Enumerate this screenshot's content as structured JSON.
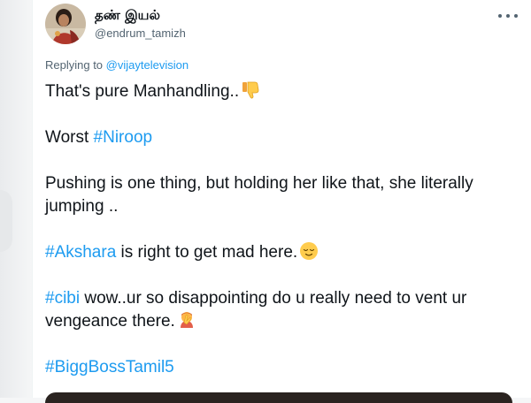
{
  "user": {
    "display_name": "தண் இயல்",
    "handle": "@endrum_tamizh"
  },
  "reply": {
    "prefix": "Replying to ",
    "mention": "@vijaytelevision"
  },
  "tweet": {
    "line1": "That's pure Manhandling..",
    "line2_prefix": "Worst ",
    "line2_hashtag": "#Niroop",
    "line3": "Pushing is one thing, but holding her like that, she literally jumping ..",
    "line4_hashtag": "#Akshara",
    "line4_rest": " is right to get mad here.",
    "line5_hashtag": "#cibi",
    "line5_rest": " wow..ur so disappointing do u really need to vent ur vengeance there.",
    "line6_hashtag": "#BiggBossTamil5"
  },
  "icons": {
    "avatar": "profile-avatar",
    "more": "more-icon",
    "thumbs_down": "thumbs-down-emoji",
    "relieved": "relieved-face-emoji",
    "facepalm": "woman-facepalming-emoji"
  },
  "colors": {
    "link": "#1d9bf0",
    "text": "#0f1419",
    "secondary": "#536471"
  }
}
